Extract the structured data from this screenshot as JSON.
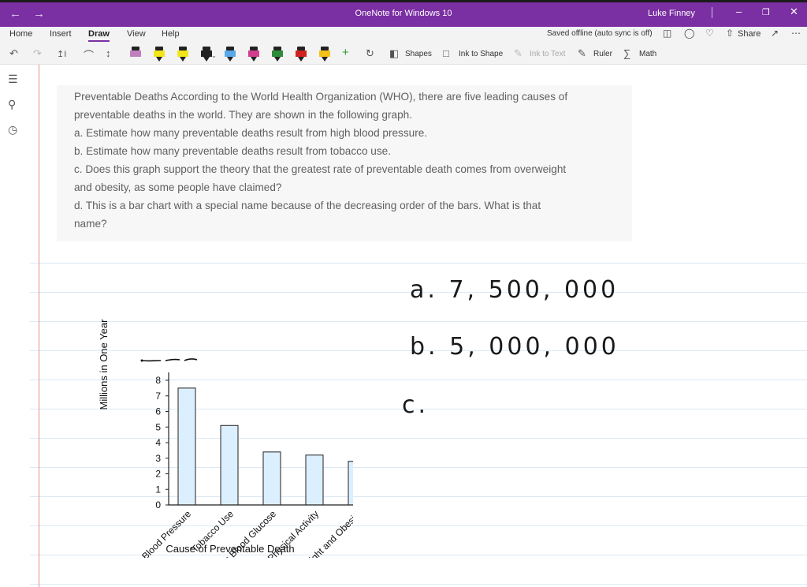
{
  "window": {
    "title": "OneNote for Windows 10",
    "user": "Luke Finney",
    "back_icon": "arrow-left-icon",
    "forward_icon": "arrow-right-icon"
  },
  "ribbon": {
    "tabs": [
      "Home",
      "Insert",
      "Draw",
      "View",
      "Help"
    ],
    "active_tab": "Draw",
    "status": "Saved offline (auto sync is off)",
    "share": "Share"
  },
  "toolbar": {
    "shapes": "Shapes",
    "ink_to_shape": "Ink to Shape",
    "ink_to_text": "Ink to Text",
    "ruler": "Ruler",
    "math": "Math",
    "pen_colors": [
      "#c080c0",
      "#f2e51b",
      "#f2e51b",
      "#222222",
      "#5aa9e6",
      "#d23c8c",
      "#2e8b3a",
      "#d02020",
      "#f2c21b"
    ]
  },
  "problem": {
    "lines": [
      "Preventable Deaths According to the World Health Organization (WHO), there are five leading causes of",
      "preventable deaths in the world. They are shown in the following graph.",
      "a. Estimate how many preventable deaths result from high blood pressure.",
      "b. Estimate how many preventable deaths result from tobacco use.",
      "c. Does this graph support the theory that the greatest rate of preventable death comes from overweight",
      "and obesity, as some people have claimed?",
      "d. This is a bar chart with a special name because of the decreasing order of the bars. What is that",
      "name?"
    ]
  },
  "chart_data": {
    "type": "bar",
    "categories": [
      "High Blood Pressure",
      "Tobacco Use",
      "High Blood Glucose",
      "Physical Activity",
      "Overweight and Obesity"
    ],
    "values": [
      7.5,
      5.1,
      3.4,
      3.2,
      2.8
    ],
    "xlabel": "Cause of Preventable Death",
    "ylabel": "Millions in One Year",
    "ylim": [
      0,
      8
    ],
    "yticks": [
      0,
      1,
      2,
      3,
      4,
      5,
      6,
      7,
      8
    ],
    "bar_color": "#dcefff",
    "grid": false
  },
  "handwriting": {
    "a": "a.  7, 500, 000",
    "b": "b.  5, 000, 000",
    "c": "c."
  }
}
